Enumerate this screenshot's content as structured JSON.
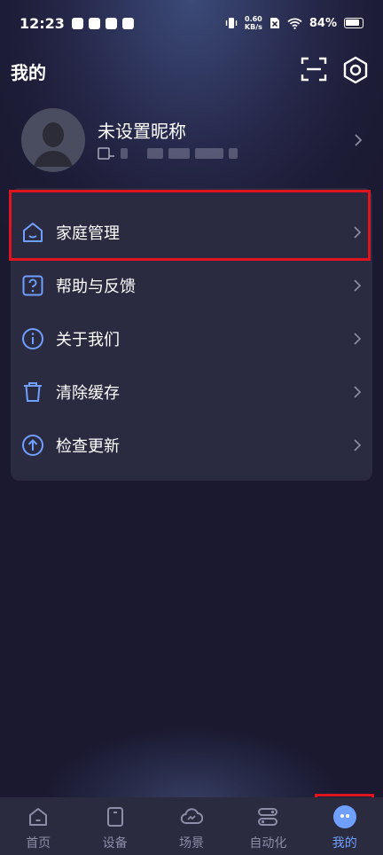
{
  "status_bar": {
    "time": "12:23",
    "net_speed_value": "0.60",
    "net_speed_unit": "KB/s",
    "battery": "84%"
  },
  "header": {
    "title": "我的"
  },
  "profile": {
    "nickname": "未设置昵称"
  },
  "menu": {
    "items": [
      {
        "label": "家庭管理",
        "icon": "home-icon"
      },
      {
        "label": "帮助与反馈",
        "icon": "help-icon"
      },
      {
        "label": "关于我们",
        "icon": "info-icon"
      },
      {
        "label": "清除缓存",
        "icon": "trash-icon"
      },
      {
        "label": "检查更新",
        "icon": "upload-icon"
      }
    ]
  },
  "tabs": [
    {
      "label": "首页",
      "icon": "home-icon"
    },
    {
      "label": "设备",
      "icon": "device-icon"
    },
    {
      "label": "场景",
      "icon": "scene-icon"
    },
    {
      "label": "自动化",
      "icon": "automation-icon"
    },
    {
      "label": "我的",
      "icon": "me-icon",
      "active": true
    }
  ],
  "colors": {
    "accent": "#6fa0ff",
    "highlight": "#e0141e",
    "card": "#2a2a40",
    "tab_bar": "#2b2b40"
  }
}
